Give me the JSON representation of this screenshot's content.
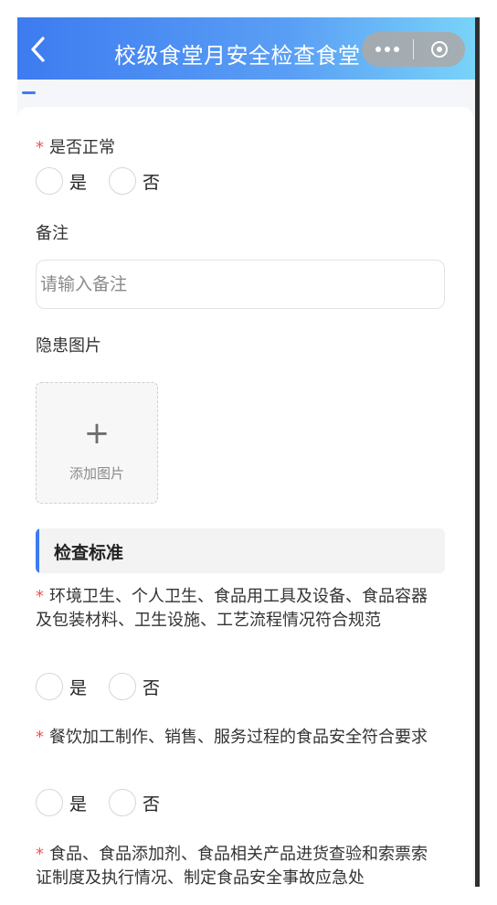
{
  "header": {
    "title": "校级食堂月安全检查食堂",
    "back_icon": "chevron-left-icon",
    "more_icon": "more-dots-icon",
    "close_icon": "target-circle-icon"
  },
  "form": {
    "normal_question": {
      "label": "是否正常",
      "options": [
        "是",
        "否"
      ]
    },
    "remark": {
      "label": "备注",
      "placeholder": "请输入备注",
      "value": ""
    },
    "hazard_images": {
      "label": "隐患图片",
      "add_label": "添加图片"
    },
    "section_title": "检查标准",
    "criteria": [
      {
        "text": "环境卫生、个人卫生、食品用工具及设备、食品容器及包装材料、卫生设施、工艺流程情况符合规范",
        "options": [
          "是",
          "否"
        ]
      },
      {
        "text": "餐饮加工制作、销售、服务过程的食品安全符合要求",
        "options": [
          "是",
          "否"
        ]
      },
      {
        "text": "食品、食品添加剂、食品相关产品进货查验和索票索证制度及执行情况、制定食品安全事故应急处"
      }
    ]
  },
  "colors": {
    "header_gradient_start": "#3d7bf0",
    "header_gradient_end": "#79d3f8",
    "required_mark": "#f05454",
    "accent": "#3d7bf0"
  }
}
